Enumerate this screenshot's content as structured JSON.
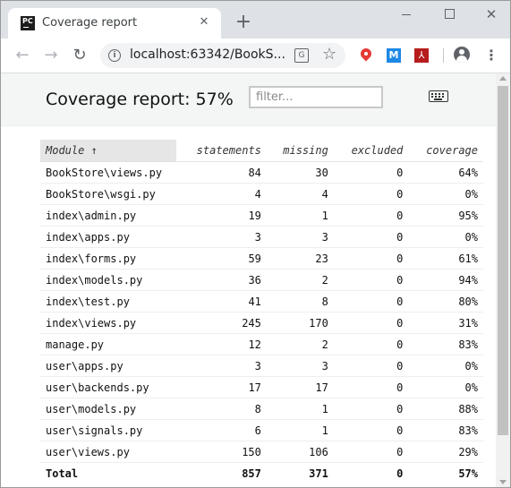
{
  "browser": {
    "tab_title": "Coverage report",
    "favicon_text": "PC",
    "url": "localhost:63342/BookS...",
    "close_glyph": "✕",
    "new_tab_glyph": "+",
    "win_close_glyph": "✕",
    "icons": [
      "back-arrow-icon",
      "forward-arrow-icon",
      "reload-icon",
      "info-icon",
      "translate-icon",
      "star-icon",
      "location-pin-icon",
      "m-extension-icon",
      "pdf-extension-icon",
      "profile-icon",
      "menu-dots-icon"
    ]
  },
  "report": {
    "title": "Coverage report: 57%",
    "filter_placeholder": "filter...",
    "columns": {
      "module": "Module ↑",
      "statements": "statements",
      "missing": "missing",
      "excluded": "excluded",
      "coverage": "coverage"
    },
    "rows": [
      {
        "module": "BookStore\\views.py",
        "statements": "84",
        "missing": "30",
        "excluded": "0",
        "coverage": "64%"
      },
      {
        "module": "BookStore\\wsgi.py",
        "statements": "4",
        "missing": "4",
        "excluded": "0",
        "coverage": "0%"
      },
      {
        "module": "index\\admin.py",
        "statements": "19",
        "missing": "1",
        "excluded": "0",
        "coverage": "95%"
      },
      {
        "module": "index\\apps.py",
        "statements": "3",
        "missing": "3",
        "excluded": "0",
        "coverage": "0%"
      },
      {
        "module": "index\\forms.py",
        "statements": "59",
        "missing": "23",
        "excluded": "0",
        "coverage": "61%"
      },
      {
        "module": "index\\models.py",
        "statements": "36",
        "missing": "2",
        "excluded": "0",
        "coverage": "94%"
      },
      {
        "module": "index\\test.py",
        "statements": "41",
        "missing": "8",
        "excluded": "0",
        "coverage": "80%"
      },
      {
        "module": "index\\views.py",
        "statements": "245",
        "missing": "170",
        "excluded": "0",
        "coverage": "31%"
      },
      {
        "module": "manage.py",
        "statements": "12",
        "missing": "2",
        "excluded": "0",
        "coverage": "83%"
      },
      {
        "module": "user\\apps.py",
        "statements": "3",
        "missing": "3",
        "excluded": "0",
        "coverage": "0%"
      },
      {
        "module": "user\\backends.py",
        "statements": "17",
        "missing": "17",
        "excluded": "0",
        "coverage": "0%"
      },
      {
        "module": "user\\models.py",
        "statements": "8",
        "missing": "1",
        "excluded": "0",
        "coverage": "88%"
      },
      {
        "module": "user\\signals.py",
        "statements": "6",
        "missing": "1",
        "excluded": "0",
        "coverage": "83%"
      },
      {
        "module": "user\\views.py",
        "statements": "150",
        "missing": "106",
        "excluded": "0",
        "coverage": "29%"
      }
    ],
    "total": {
      "module": "Total",
      "statements": "857",
      "missing": "371",
      "excluded": "0",
      "coverage": "57%"
    }
  }
}
